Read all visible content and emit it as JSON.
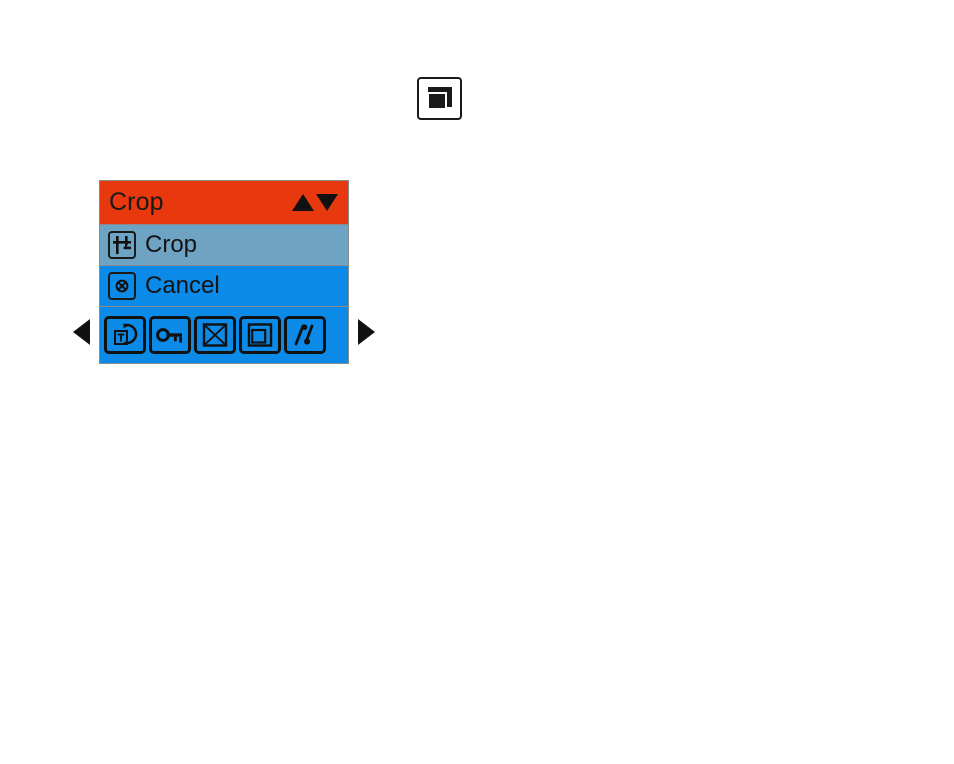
{
  "top_button": {
    "name": "crop-tool-button",
    "icon": "crop-window-icon"
  },
  "panel": {
    "header": {
      "title": "Crop",
      "scroll_up_icon": "triangle-up-icon",
      "scroll_down_icon": "triangle-down-icon"
    },
    "menu_items": [
      {
        "label": "Crop",
        "icon": "crop-marks-icon",
        "selected": true
      },
      {
        "label": "Cancel",
        "icon": "circle-x-icon",
        "selected": false
      }
    ],
    "toolbar": [
      {
        "name": "text-rotate-tool",
        "icon": "text-rotate-icon"
      },
      {
        "name": "key-tool",
        "icon": "key-icon"
      },
      {
        "name": "crossed-box-tool",
        "icon": "crossed-box-icon"
      },
      {
        "name": "crop-window-tool",
        "icon": "crop-window-icon"
      },
      {
        "name": "signature-tool",
        "icon": "signature-notes-icon"
      }
    ],
    "nav": {
      "prev_icon": "triangle-left-icon",
      "next_icon": "triangle-right-icon"
    }
  },
  "colors": {
    "header_bg": "#e8380d",
    "selected_row_bg": "#6fa3c4",
    "row_bg": "#0b8ae8",
    "panel_border": "#8a8a8a",
    "ink": "#111111",
    "page_bg": "#ffffff"
  }
}
